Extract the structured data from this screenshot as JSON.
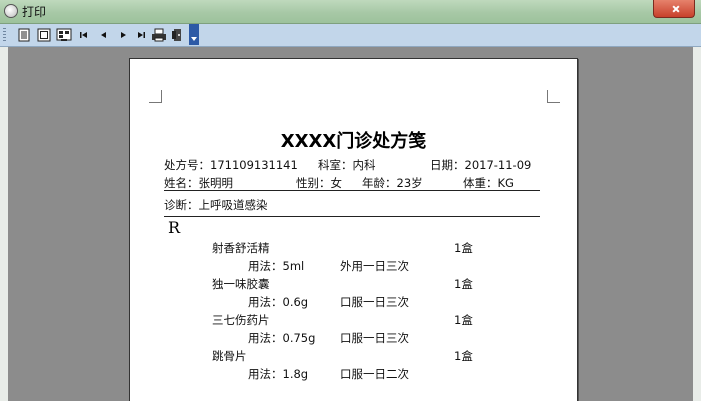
{
  "window": {
    "title": "打印"
  },
  "toolbar": {
    "buttons": [
      {
        "name": "single-page-icon"
      },
      {
        "name": "two-page-icon"
      },
      {
        "name": "multi-page-icon"
      },
      {
        "name": "first-page-icon"
      },
      {
        "name": "prev-page-icon"
      },
      {
        "name": "next-page-icon"
      },
      {
        "name": "last-page-icon"
      },
      {
        "name": "print-icon"
      },
      {
        "name": "close-preview-icon"
      }
    ]
  },
  "document": {
    "title": "XXXX门诊处方笺",
    "header": {
      "rx_no": "处方号：171109131141",
      "dept": "科室：内科",
      "date": "日期：2017-11-09",
      "name": "姓名：张明明",
      "gender": "性别：女",
      "age": "年龄：23岁",
      "weight": "体重：KG"
    },
    "diagnosis": "诊断：上呼吸道感染",
    "rx_symbol": "R",
    "medicines": [
      {
        "name": "射香舒活精",
        "qty": "1盒",
        "usage_label": "用法：5ml",
        "usage": "外用一日三次"
      },
      {
        "name": "独一味胶囊",
        "qty": "1盒",
        "usage_label": "用法：0.6g",
        "usage": "口服一日三次"
      },
      {
        "name": "三七伤药片",
        "qty": "1盒",
        "usage_label": "用法：0.75g",
        "usage": "口服一日三次"
      },
      {
        "name": "跳骨片",
        "qty": "1盒",
        "usage_label": "用法：1.8g",
        "usage": "口服一日二次"
      }
    ]
  }
}
